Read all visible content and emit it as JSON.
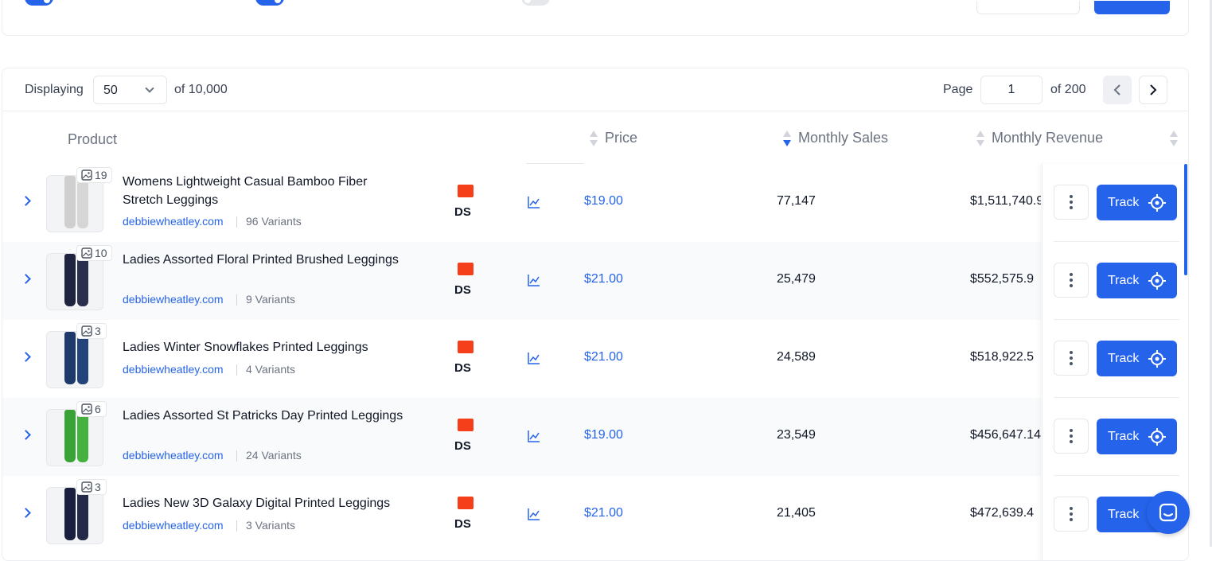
{
  "pagination": {
    "displaying_label": "Displaying",
    "per_page": "50",
    "of_total": "of 10,000",
    "page_label": "Page",
    "current_page": "1",
    "of_pages": "of 200"
  },
  "columns": {
    "product": "Product",
    "price": "Price",
    "monthly_sales": "Monthly Sales",
    "monthly_revenue": "Monthly Revenue"
  },
  "rows": [
    {
      "image_count": "19",
      "name": "Womens Lightweight Casual Bamboo Fiber Stretch Leggings",
      "store": "debbiewheatley.com",
      "variants": "96 Variants",
      "badge": "DS",
      "price": "$19.00",
      "sales": "77,147",
      "revenue": "$1,511,740.9"
    },
    {
      "image_count": "10",
      "name": "Ladies Assorted Floral Printed Brushed Leggings",
      "store": "debbiewheatley.com",
      "variants": "9 Variants",
      "badge": "DS",
      "price": "$21.00",
      "sales": "25,479",
      "revenue": "$552,575.9"
    },
    {
      "image_count": "3",
      "name": "Ladies Winter Snowflakes Printed Leggings",
      "store": "debbiewheatley.com",
      "variants": "4 Variants",
      "badge": "DS",
      "price": "$21.00",
      "sales": "24,589",
      "revenue": "$518,922.5"
    },
    {
      "image_count": "6",
      "name": "Ladies Assorted St Patricks Day Printed Leggings",
      "store": "debbiewheatley.com",
      "variants": "24 Variants",
      "badge": "DS",
      "price": "$19.00",
      "sales": "23,549",
      "revenue": "$456,647.14"
    },
    {
      "image_count": "3",
      "name": "Ladies New 3D Galaxy Digital Printed Leggings",
      "store": "debbiewheatley.com",
      "variants": "3 Variants",
      "badge": "DS",
      "price": "$21.00",
      "sales": "21,405",
      "revenue": "$472,639.4"
    }
  ],
  "actions": {
    "track_label": "Track"
  },
  "colors": {
    "accent": "#2563eb",
    "aliexpress": "#f43f1a"
  },
  "icons": [
    "image-icon",
    "expand-chevron-icon",
    "trend-chart-icon",
    "kebab-menu-icon",
    "target-icon",
    "chat-icon",
    "chevron-left-icon",
    "chevron-right-icon"
  ]
}
